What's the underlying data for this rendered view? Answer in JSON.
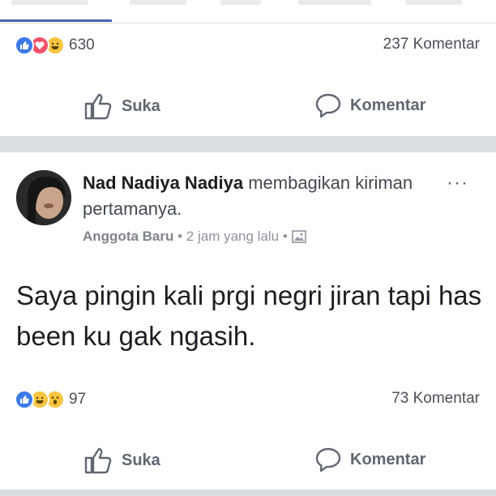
{
  "post1": {
    "reaction_count": "630",
    "comment_count": "237 Komentar",
    "like_label": "Suka",
    "comment_label": "Komentar"
  },
  "post2": {
    "author_name": "Nad Nadiya Nadiya",
    "action_text": " membagikan kiriman pertamanya.",
    "group_badge": "Anggota Baru",
    "timestamp": "2 jam yang lalu",
    "body_text": "Saya pingin kali prgi negri jiran tapi has been ku gak ngasih.",
    "reaction_count": "97",
    "comment_count": "73 Komentar",
    "like_label": "Suka",
    "comment_label": "Komentar",
    "more_icon": "···"
  },
  "icons": [
    "like-icon",
    "love-icon",
    "haha-icon",
    "wow-icon",
    "thumbs-up-icon",
    "comment-bubble-icon",
    "public-photo-icon",
    "more-options-icon"
  ],
  "colors": {
    "like": "#3b79e7",
    "love": "#f25268",
    "haha": "#f7c541",
    "accent": "#4267b2"
  }
}
